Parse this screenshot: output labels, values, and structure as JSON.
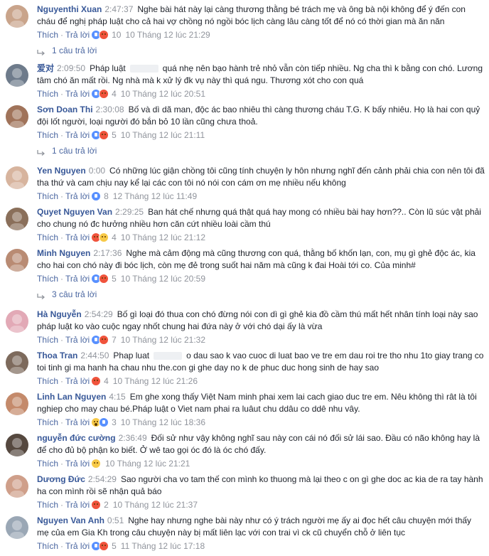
{
  "labels": {
    "like": "Thích",
    "reply": "Trả lời",
    "sep": "·"
  },
  "comments": [
    {
      "name": "Nguyenthi Xuan",
      "time": "2:47:37",
      "text": "Nghe bài hát này lại càng thương thằng bé trách mẹ và ông bà nội không để ý đến con cháu để nghị pháp luật cho cả hai vợ chồng nó ngồi bóc lịch càng lâu càng tốt để nó có thời gian mà ăn năn",
      "reactions": [
        "like",
        "angry"
      ],
      "count": "10",
      "date": "10 Tháng 12 lúc 21:29",
      "replies": "1 câu trả lời",
      "redacted": false
    },
    {
      "name": "爱对",
      "time": "2:09:50",
      "text_a": "Pháp luật",
      "text": "quá nhẹ nên bạo hành trẻ nhỏ vẫn còn tiếp nhiều. Ng cha thì k bằng con chó. Lương tâm chó ăn mất rồi. Ng nhà mà k xử lý đk vụ này thì quá ngu. Thương xót cho con quá",
      "reactions": [
        "like",
        "angry"
      ],
      "count": "4",
      "date": "10 Tháng 12 lúc 20:51",
      "replies": "",
      "redacted": true
    },
    {
      "name": "Sơn Doan Thi",
      "time": "2:30:08",
      "text": "Bố và dì dã man, độc ác bao nhiêu thì càng thương cháu T.G. K bấy nhiêu. Họ là hai con quỷ đội lốt người, loại người đó bắn bỏ 10 lần cũng chưa thoả.",
      "reactions": [
        "like",
        "angry"
      ],
      "count": "5",
      "date": "10 Tháng 12 lúc 21:11",
      "replies": "1 câu trả lời",
      "redacted": false
    },
    {
      "name": "Yen Nguyen",
      "time": "0:00",
      "text": "Có những lúc giận chồng tôi cũng tính chuyện ly hôn nhưng nghĩ đến cảnh phải chia con nên tôi đã tha thứ và cam chịu nay kể lại các con tôi nó nói con cám ơn mẹ nhiều nếu không",
      "reactions": [
        "like"
      ],
      "count": "8",
      "date": "12 Tháng 12 lúc 11:49",
      "replies": "",
      "redacted": false
    },
    {
      "name": "Quyet Nguyen Van",
      "time": "2:29:25",
      "text": "Ban hát chế nhưng quá thật quá hay mong có nhiều bài hay hơn??.. Còn lũ súc vật phải cho chung nó đc hưởng nhiều hơn căn cứt nhiều loài cầm thú",
      "reactions": [
        "angry",
        "sad"
      ],
      "count": "4",
      "date": "10 Tháng 12 lúc 21:12",
      "replies": "",
      "redacted": false
    },
    {
      "name": "Minh Nguyen",
      "time": "2:17:36",
      "text": "Nghe mà cảm động mà cũng thương con quá, thằng bố khốn lạn, con, mụ gì ghẻ độc ác, kia cho hai con chó này đi bóc lịch, còn mẹ đẻ trong suốt hai năm mà cũng k đai Hoài tới co. Của minh#",
      "reactions": [
        "like",
        "angry"
      ],
      "count": "5",
      "date": "10 Tháng 12 lúc 20:59",
      "replies": "3 câu trả lời",
      "redacted": false
    },
    {
      "name": "Hà Nguyễn",
      "time": "2:54:29",
      "text": "Bố gì loại đó thua con chó đừng nói con dì gì ghẻ kia đồ cầm thú mất hết nhân tính loại này sao pháp luật ko vào cuộc ngay nhốt chung hai đứa này ở với chó dại ấy là vừa",
      "reactions": [
        "like",
        "angry"
      ],
      "count": "7",
      "date": "10 Tháng 12 lúc 21:32",
      "replies": "",
      "redacted": false
    },
    {
      "name": "Thoa Tran",
      "time": "2:44:50",
      "text_a": "Phap luat",
      "text": "o dau sao k vao cuoc di luat bao ve tre em dau roi tre tho nhu 1to giay trang co toi tinh gi ma hanh ha chau nhu the.con gi ghe day no k de phuc duc hong sinh de hay sao",
      "reactions": [
        "angry"
      ],
      "count": "4",
      "date": "10 Tháng 12 lúc 21:26",
      "replies": "",
      "redacted": true
    },
    {
      "name": "Linh Lan Nguyen",
      "time": "4:15",
      "text": "Em ghe xong thấy Việt Nam minh phai xem lai cach giao duc tre em. Nêu không thì rât là tôi nghiep cho may chau bé.Pháp luật o Viet nam phai ra luâut chu ddâu co ddê nhu vây.",
      "reactions": [
        "wow",
        "like"
      ],
      "count": "3",
      "date": "10 Tháng 12 lúc 18:36",
      "replies": "",
      "redacted": false
    },
    {
      "name": "nguyễn đức cường",
      "time": "2:36:49",
      "text": "Đối sử như vậy không nghĩ sau này con cái nó đối sử lái sao. Đầu có não không hay là để cho đủ bộ phận ko biết. Ở wê tao gọi óc đó là óc chó đấy.",
      "reactions": [
        "sad"
      ],
      "count": "",
      "date": "10 Tháng 12 lúc 21:21",
      "replies": "",
      "redacted": false
    },
    {
      "name": "Dương Đức",
      "time": "2:54:29",
      "text": "Sao người cha vo tam thế con mình ko thuong mà lại theo c on gì ghe doc ac kia de ra tay hành ha con mình rồi sẽ nhận quả báo",
      "reactions": [
        "angry"
      ],
      "count": "2",
      "date": "10 Tháng 12 lúc 21:37",
      "replies": "",
      "redacted": false
    },
    {
      "name": "Nguyen Van Anh",
      "time": "0:51",
      "text": "Nghe hay nhưng nghe bài này như có ý trách người mẹ ấy ai đọc hết câu chuyện mới thấy mẹ của em Gia Kh trong câu chuyện này bị mất liên lạc với con trai vì ck cũ chuyển chỗ ở liên tục",
      "reactions": [
        "like",
        "angry"
      ],
      "count": "5",
      "date": "11 Tháng 12 lúc 17:18",
      "replies": "",
      "redacted": false
    }
  ]
}
